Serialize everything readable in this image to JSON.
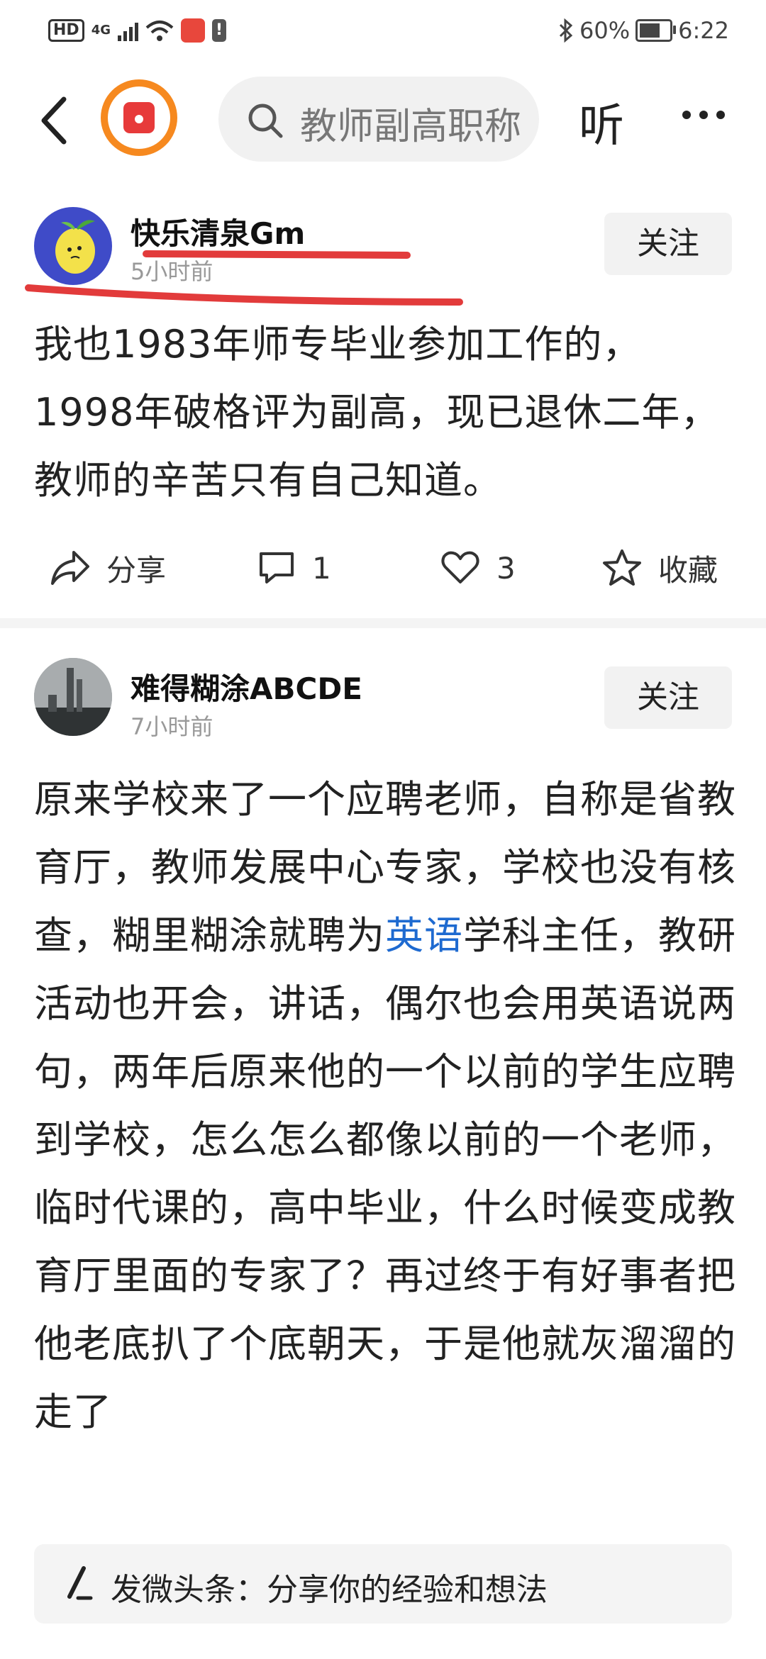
{
  "status_bar": {
    "hd": "HD",
    "network": "4G",
    "bluetooth_icon": "bluetooth-icon",
    "battery_text": "60%",
    "time": "6:22"
  },
  "nav": {
    "search_text": "教师副高职称",
    "listen_label": "听",
    "more_label": "···"
  },
  "posts": [
    {
      "username": "快乐清泉Gm",
      "time": "5小时前",
      "follow_label": "关注",
      "content_parts": [
        "我也",
        "1983年师专毕业",
        "参加工作的，",
        "1998年破格评为副高，",
        "现已退休二年，教师的辛苦只有自己知道。"
      ],
      "actions": {
        "share": "分享",
        "comments": "1",
        "likes": "3",
        "favorite": "收藏"
      }
    },
    {
      "username": "难得糊涂ABCDE",
      "time": "7小时前",
      "follow_label": "关注",
      "content_before": "原来学校来了一个应聘老师，自称是省教育厅，教师发展中心专家，学校也没有核查，糊里糊涂就聘为",
      "content_link": "英语",
      "content_after": "学科主任，教研活动也开会，讲话，偶尔也会用英语说两句，两年后原来他的一个以前的学生应聘到学校，怎么怎么都像以前的一个老师，临时代课的，高中毕业，什么时候变成教育厅里面的专家了？再过终于有好事者把他老底扒了个底朝天，于是他就灰溜溜的走了"
    }
  ],
  "composer": {
    "placeholder": "发微头条：分享你的经验和想法"
  },
  "colors": {
    "accent_orange": "#f6891f",
    "link_blue": "#1e6ad0",
    "underline_red": "#e23b3b"
  }
}
